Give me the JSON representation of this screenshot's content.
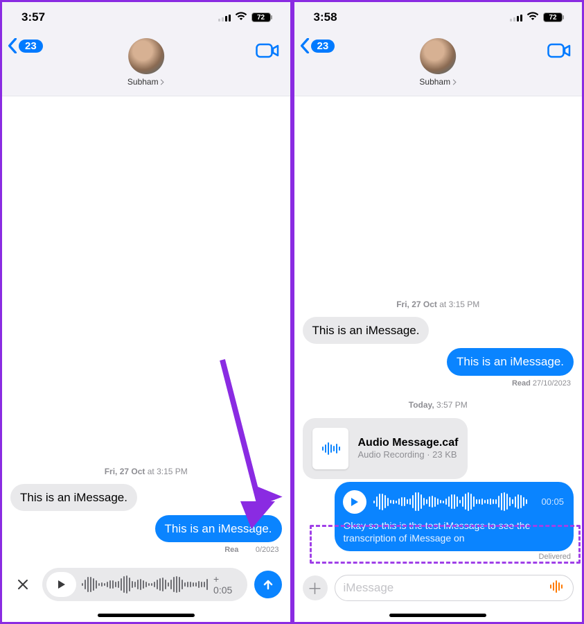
{
  "left": {
    "status": {
      "time": "3:57",
      "battery": "72"
    },
    "nav": {
      "back_count": "23",
      "contact": "Subham"
    },
    "timestamp": "Fri, 27 Oct at 3:15 PM",
    "msg_in": "This is an iMessage.",
    "msg_out": "This is an iMessage.",
    "read_label": "Rea",
    "read_date": "0/2023",
    "duration": "+ 0:05"
  },
  "right": {
    "status": {
      "time": "3:58",
      "battery": "72"
    },
    "nav": {
      "back_count": "23",
      "contact": "Subham"
    },
    "timestamp1": "Fri, 27 Oct at 3:15 PM",
    "msg_in": "This is an iMessage.",
    "msg_out": "This is an iMessage.",
    "read_full": "Read 27/10/2023",
    "timestamp2": "Today, 3:57 PM",
    "file": {
      "title": "Audio Message.caf",
      "sub": "Audio Recording · 23 KB"
    },
    "audio_dur": "00:05",
    "transcript": "Okay so this is the test iMessage to see the transcription of iMessage on",
    "delivered": "Delivered",
    "compose_placeholder": "iMessage"
  }
}
